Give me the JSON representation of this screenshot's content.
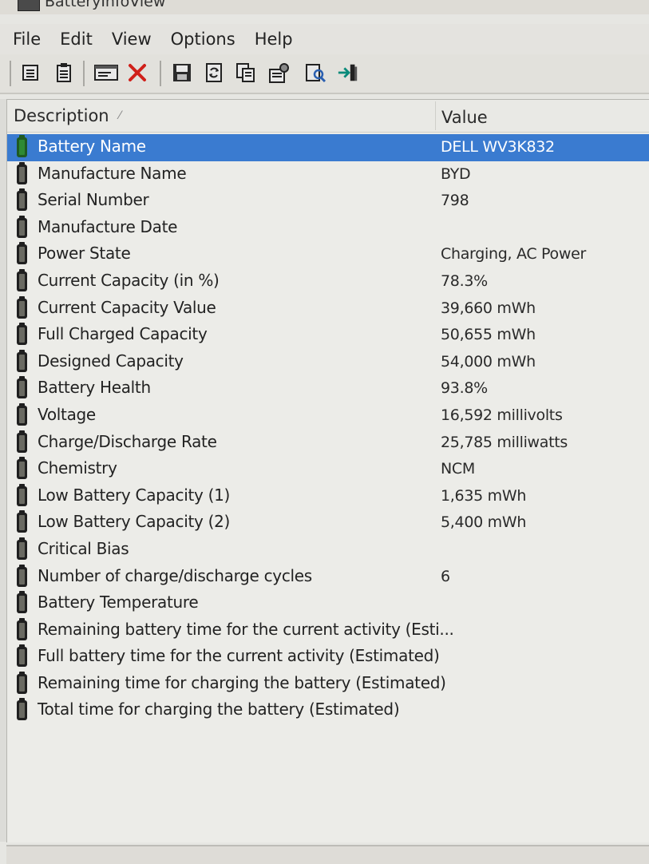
{
  "window": {
    "title": "BatteryInfoView"
  },
  "menu": [
    "File",
    "Edit",
    "View",
    "Options",
    "Help"
  ],
  "toolbar": {
    "buttons": [
      "properties-icon",
      "clipboard-icon",
      "html-report-icon",
      "delete-icon",
      "save-icon",
      "refresh-icon",
      "copy-icon",
      "options-icon",
      "find-icon",
      "exit-icon"
    ]
  },
  "list": {
    "columns": {
      "description": "Description",
      "value": "Value"
    },
    "rows": [
      {
        "description": "Battery Name",
        "value": "DELL WV3K832",
        "selected": true
      },
      {
        "description": "Manufacture Name",
        "value": "BYD"
      },
      {
        "description": "Serial Number",
        "value": "798"
      },
      {
        "description": "Manufacture Date",
        "value": ""
      },
      {
        "description": "Power State",
        "value": "Charging, AC Power"
      },
      {
        "description": "Current Capacity (in %)",
        "value": "78.3%"
      },
      {
        "description": "Current Capacity Value",
        "value": "39,660 mWh"
      },
      {
        "description": "Full Charged Capacity",
        "value": "50,655 mWh"
      },
      {
        "description": "Designed Capacity",
        "value": "54,000 mWh"
      },
      {
        "description": "Battery Health",
        "value": "93.8%"
      },
      {
        "description": "Voltage",
        "value": "16,592 millivolts"
      },
      {
        "description": "Charge/Discharge Rate",
        "value": "25,785 milliwatts"
      },
      {
        "description": "Chemistry",
        "value": "NCM"
      },
      {
        "description": "Low Battery Capacity (1)",
        "value": "1,635 mWh"
      },
      {
        "description": "Low Battery Capacity (2)",
        "value": "5,400 mWh"
      },
      {
        "description": "Critical Bias",
        "value": ""
      },
      {
        "description": "Number of charge/discharge cycles",
        "value": "6"
      },
      {
        "description": "Battery Temperature",
        "value": ""
      },
      {
        "description": "Remaining battery time for the current activity (Esti...",
        "value": ""
      },
      {
        "description": "Full battery time for the current activity (Estimated)",
        "value": ""
      },
      {
        "description": "Remaining time for charging the battery (Estimated)",
        "value": ""
      },
      {
        "description": "Total  time for charging the battery (Estimated)",
        "value": ""
      }
    ]
  },
  "colors": {
    "selection": "#3a7bd0",
    "background": "#ecece8"
  }
}
